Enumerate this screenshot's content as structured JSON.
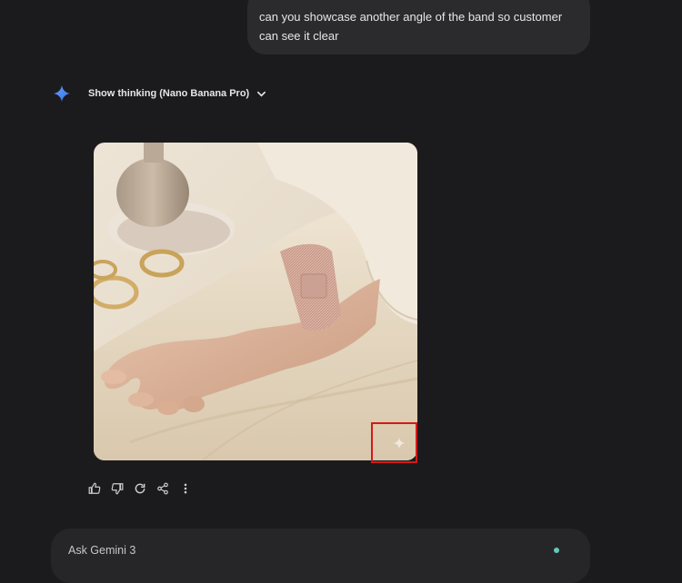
{
  "conversation": {
    "user_message": "can you showcase another angle of the band so customer can see it clear",
    "model_thinking_label": "Show thinking (Nano Banana Pro)",
    "generated_image_alt": "Hand wearing rose gold mesh watch band resting on cream fabric"
  },
  "actions": {
    "icons": [
      "thumbs-up-icon",
      "thumbs-down-icon",
      "refresh-icon",
      "share-icon",
      "more-vert-icon"
    ]
  },
  "composer": {
    "placeholder": "Ask Gemini 3"
  },
  "colors": {
    "background": "#1b1b1d",
    "bubble": "#2b2b2e",
    "composer": "#262628",
    "gemini_blue": "#4f86f7",
    "highlight_red": "#d41919",
    "status_dot": "#64c9b6"
  }
}
